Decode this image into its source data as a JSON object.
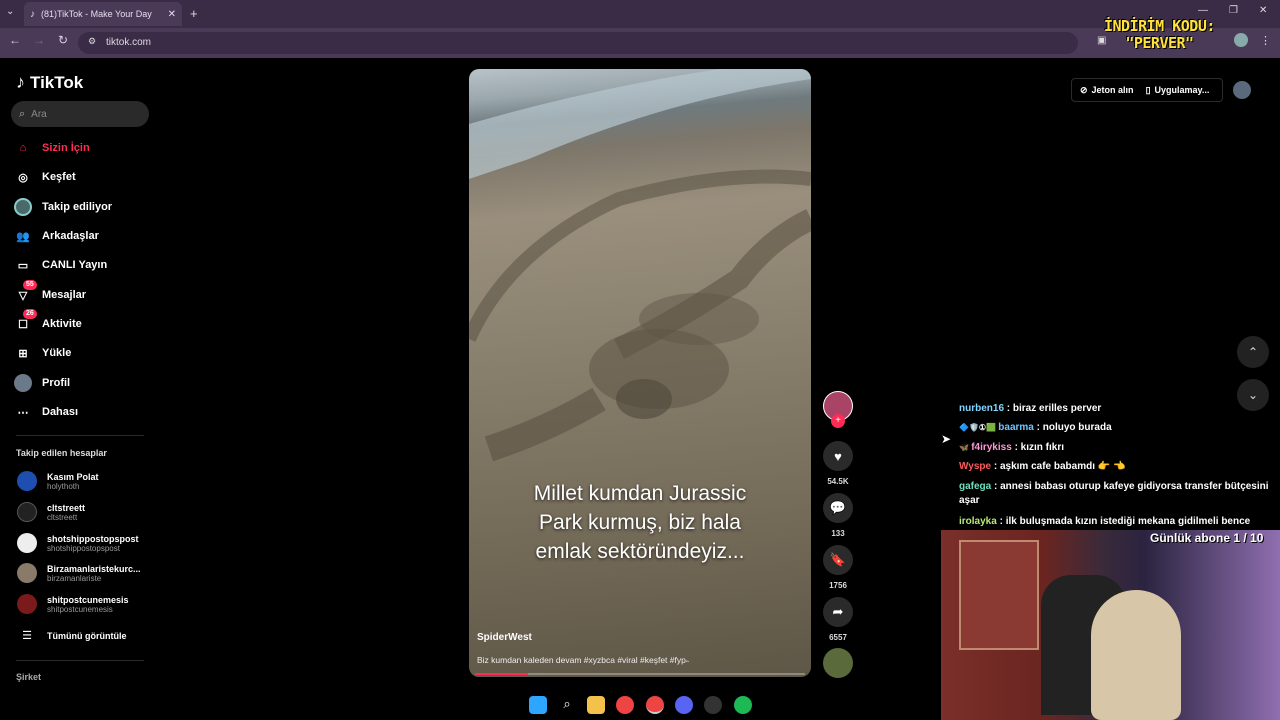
{
  "browser": {
    "tab_title": "(81)TikTok - Make Your Day",
    "url": "tiktok.com",
    "promo_line1": "İNDİRİM KODU:",
    "promo_line2": "\"PERVER\""
  },
  "sidebar": {
    "brand": "TikTok",
    "search_placeholder": "Ara",
    "nav": [
      {
        "label": "Sizin İçin",
        "icon": "home-icon"
      },
      {
        "label": "Keşfet",
        "icon": "compass-icon"
      },
      {
        "label": "Takip ediliyor",
        "icon": "following-avatar-icon"
      },
      {
        "label": "Arkadaşlar",
        "icon": "friends-icon"
      },
      {
        "label": "CANLI Yayın",
        "icon": "live-icon"
      },
      {
        "label": "Mesajlar",
        "icon": "messages-icon",
        "badge": "55"
      },
      {
        "label": "Aktivite",
        "icon": "activity-icon",
        "badge": "26"
      },
      {
        "label": "Yükle",
        "icon": "upload-icon"
      },
      {
        "label": "Profil",
        "icon": "profile-avatar-icon"
      },
      {
        "label": "Dahası",
        "icon": "more-icon"
      }
    ],
    "following_header": "Takip edilen hesaplar",
    "following": [
      {
        "name": "Kasım Polat",
        "handle": "holythoth"
      },
      {
        "name": "cltstreett",
        "handle": "cltstreett"
      },
      {
        "name": "shotshippostopspost",
        "handle": "shotshippostopspost"
      },
      {
        "name": "Birzamanlaristekurc...",
        "handle": "birzamanlariste"
      },
      {
        "name": "shitpostcunemesis",
        "handle": "shitpostcunemesis"
      }
    ],
    "see_all": "Tümünü görüntüle",
    "footer_label": "Şirket"
  },
  "video": {
    "caption_line1": "Millet kumdan Jurassic",
    "caption_line2": "Park kurmuş, biz hala",
    "caption_line3": "emlak sektöründeyiz...",
    "author": "SpiderWest",
    "description": "Biz kumdan kaleden devam #xyzbca #viral #keşfet #fyp˵",
    "progress": 0.16
  },
  "actions": {
    "likes": "54.5K",
    "comments": "133",
    "saves": "1756",
    "shares": "6557"
  },
  "topright": {
    "coins_label": "Jeton alın",
    "app_label": "Uygulamay..."
  },
  "chat": [
    {
      "user": "nurben16",
      "text": ": biraz erilles perver",
      "color": "#7fd7ff"
    },
    {
      "user": "baarma",
      "text": ": noluyo burada",
      "color": "#6fc6ff",
      "prefix": "🔷🛡️①🟩 "
    },
    {
      "user": "f4irykiss",
      "text": ": kızın fıkrı",
      "color": "#ff9ad8",
      "prefix": "🦋 "
    },
    {
      "user": "Wyspe",
      "text": ": aşkım cafe babamdı 👉 👈",
      "color": "#ff5a5a"
    },
    {
      "user": "gafega",
      "text": ": annesi babası oturup kafeye gidiyorsa transfer bütçesini aşar",
      "color": "#6fe0c0"
    },
    {
      "user": "irolayka",
      "text": ": ilk buluşmada kızın istediği mekana gidilmeli bence",
      "color": "#b8e87a"
    }
  ],
  "stream_overlay": {
    "sub_goal": "Günlük abone 1 / 10"
  }
}
